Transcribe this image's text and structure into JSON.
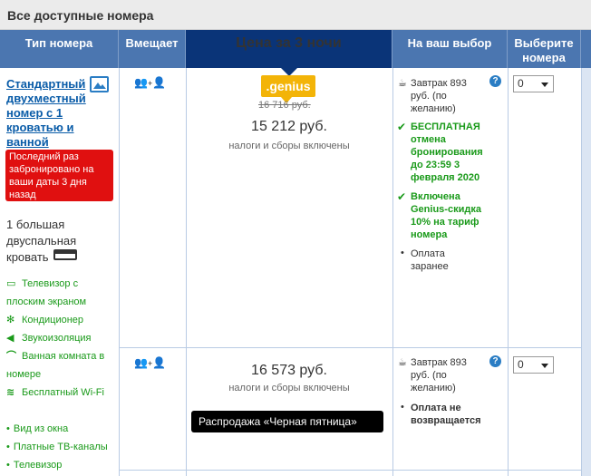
{
  "section_title": "Все доступные номера",
  "columns": {
    "room_type": "Тип номера",
    "sleeps": "Вмещает",
    "price": "Цена за 3 ночи",
    "your_choice": "На ваш выбор",
    "select": "Выберите номера"
  },
  "room": {
    "name": "Стандартный двухместный номер с 1 кроватью и ванной",
    "last_booked": "Последний раз забронировано на ваши даты 3 дня назад",
    "bed": "1 большая двуспальная кровать",
    "facilities": [
      {
        "icon": "tv-icon",
        "label": "Телевизор с плоским экраном"
      },
      {
        "icon": "snowflake-icon",
        "label": "Кондиционер"
      },
      {
        "icon": "speaker-icon",
        "label": "Звукоизоляция"
      },
      {
        "icon": "shower-icon",
        "label": "Ванная комната в номере"
      },
      {
        "icon": "wifi-icon",
        "label": "Бесплатный Wi-Fi"
      },
      {
        "icon": "bullet",
        "label": "Вид из окна"
      },
      {
        "icon": "bullet",
        "label": "Платные ТВ-каналы"
      },
      {
        "icon": "bullet",
        "label": "Телевизор"
      }
    ]
  },
  "rates": [
    {
      "guests": "2 + 1",
      "badge": ".genius",
      "old_price": "16 716 руб.",
      "price": "15 212 руб.",
      "taxes": "налоги и сборы включены",
      "breakfast": "Завтрак 893 руб. (по желанию)",
      "cancellation": "БЕСПЛАТНАЯ отмена бронирования до 23:59 3 февраля 2020",
      "genius_discount": "Включена Genius-скидка 10% на тариф номера",
      "payment": "Оплата заранее",
      "qty": "0"
    },
    {
      "guests": "2 + 1",
      "price": "16 573 руб.",
      "taxes": "налоги и сборы включены",
      "promo": "Распродажа «Черная пятница»",
      "breakfast": "Завтрак 893 руб. (по желанию)",
      "payment": "Оплата не возвращается",
      "qty": "0"
    }
  ],
  "colors": {
    "header_blue": "#4b76b0",
    "price_header": "#0a3478",
    "genius_yellow": "#f3b408",
    "green": "#1a9a1a",
    "alert_red": "#e01010"
  }
}
